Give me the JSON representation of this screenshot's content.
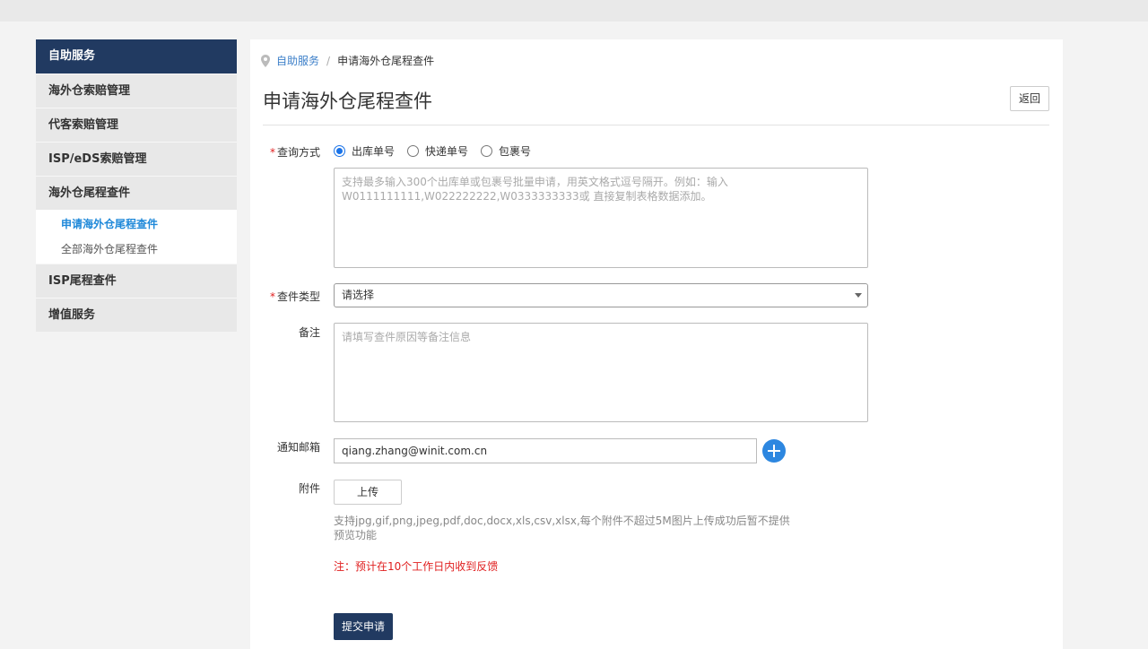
{
  "sidebar": {
    "header": "自助服务",
    "items": [
      {
        "label": "海外仓索赔管理"
      },
      {
        "label": "代客索赔管理"
      },
      {
        "label": "ISP/eDS索赔管理"
      },
      {
        "label": "海外仓尾程查件"
      }
    ],
    "sub_items": [
      {
        "label": "申请海外仓尾程查件",
        "active": true
      },
      {
        "label": "全部海外仓尾程查件",
        "active": false
      }
    ],
    "items_after": [
      {
        "label": "ISP尾程查件"
      },
      {
        "label": "增值服务"
      }
    ]
  },
  "breadcrumb": {
    "parent": "自助服务",
    "separator": "/",
    "current": "申请海外仓尾程查件"
  },
  "page": {
    "title": "申请海外仓尾程查件",
    "back_label": "返回"
  },
  "form": {
    "query_method": {
      "label": "查询方式",
      "options": [
        {
          "label": "出库单号",
          "checked": true
        },
        {
          "label": "快递单号",
          "checked": false
        },
        {
          "label": "包裹号",
          "checked": false
        }
      ]
    },
    "numbers_placeholder": "支持最多输入300个出库单或包裹号批量申请，用英文格式逗号隔开。例如：输入W0111111111,W022222222,W0333333333或 直接复制表格数据添加。",
    "query_type": {
      "label": "查件类型",
      "placeholder": "请选择"
    },
    "remark": {
      "label": "备注",
      "placeholder": "请填写查件原因等备注信息"
    },
    "email": {
      "label": "通知邮箱",
      "value": "qiang.zhang@winit.com.cn"
    },
    "attachment": {
      "label": "附件",
      "upload_label": "上传",
      "hint": "支持jpg,gif,png,jpeg,pdf,doc,docx,xls,csv,xlsx,每个附件不超过5M图片上传成功后暂不提供预览功能"
    },
    "note": "注：预计在10个工作日内收到反馈",
    "submit_label": "提交申请",
    "required_mark": "*"
  },
  "colors": {
    "brand": "#213a61",
    "link": "#3c7fc9",
    "active": "#1e88d9",
    "required": "#e02020",
    "add_button": "#2d87e0"
  }
}
